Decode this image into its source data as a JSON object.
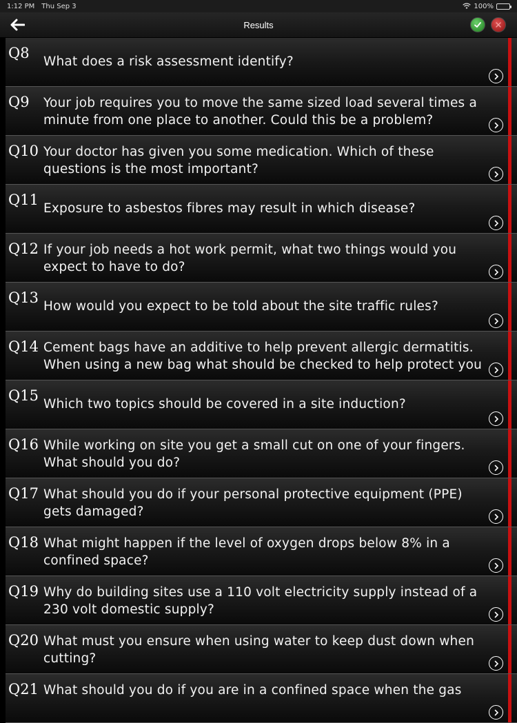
{
  "status": {
    "time": "1:12 PM",
    "date": "Thu Sep 3",
    "battery": "100%"
  },
  "nav": {
    "title": "Results"
  },
  "colors": {
    "wrong_bar": "#c81010",
    "correct_icon": "#2a9a2a",
    "cancel_icon": "#b01515"
  },
  "questions": [
    {
      "num": "Q8",
      "text": "What does a risk assessment identify?"
    },
    {
      "num": "Q9",
      "text": "Your job requires you to move the same sized load several times a minute from one place to another. Could this be a problem?"
    },
    {
      "num": "Q10",
      "text": "Your doctor has given you some medication. Which of these questions is the most important?"
    },
    {
      "num": "Q11",
      "text": "Exposure to asbestos fibres may result in which disease?"
    },
    {
      "num": "Q12",
      "text": "If your job needs a hot work permit, what two things would you expect to have to do?"
    },
    {
      "num": "Q13",
      "text": "How would you expect to be told about the site traffic rules?"
    },
    {
      "num": "Q14",
      "text": "Cement bags have an additive to help prevent allergic dermatitis. When using a new bag what should be checked to help protect you"
    },
    {
      "num": "Q15",
      "text": "Which two topics should be covered in a site induction?"
    },
    {
      "num": "Q16",
      "text": "While working on site you get a small cut on one of your fingers. What should you do?"
    },
    {
      "num": "Q17",
      "text": "What should you do if your personal protective equipment (PPE) gets damaged?"
    },
    {
      "num": "Q18",
      "text": "What might happen if the level of oxygen drops below 8% in a confined space?"
    },
    {
      "num": "Q19",
      "text": "Why do building sites use a 110 volt electricity supply instead of a 230 volt domestic supply?"
    },
    {
      "num": "Q20",
      "text": "What must you ensure when using water to keep dust down when cutting?"
    },
    {
      "num": "Q21",
      "text": "What should you do if you are in a confined space when the gas"
    }
  ]
}
